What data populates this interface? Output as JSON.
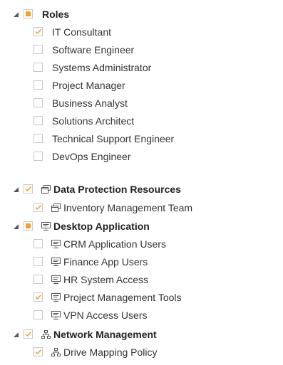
{
  "colors": {
    "check": "#f0a030",
    "border": "#c8c8c8",
    "text": "#333333",
    "icon": "#555555"
  },
  "tree": [
    {
      "label": "Roles",
      "state": "partial",
      "icon": null,
      "children": [
        {
          "label": "IT Consultant",
          "state": "checked",
          "icon": null
        },
        {
          "label": "Software Engineer",
          "state": "unchecked",
          "icon": null
        },
        {
          "label": "Systems Administrator",
          "state": "unchecked",
          "icon": null
        },
        {
          "label": "Project Manager",
          "state": "unchecked",
          "icon": null
        },
        {
          "label": "Business Analyst",
          "state": "unchecked",
          "icon": null
        },
        {
          "label": "Solutions Architect",
          "state": "unchecked",
          "icon": null
        },
        {
          "label": "Technical Support Engineer",
          "state": "unchecked",
          "icon": null
        },
        {
          "label": "DevOps Engineer",
          "state": "unchecked",
          "icon": null
        }
      ]
    },
    {
      "label": "Data Protection Resources",
      "state": "checked",
      "icon": "stacked-windows-icon",
      "children": [
        {
          "label": "Inventory Management Team",
          "state": "checked",
          "icon": "stacked-windows-icon"
        }
      ]
    },
    {
      "label": "Desktop Application",
      "state": "partial",
      "icon": "desktop-app-icon",
      "children": [
        {
          "label": "CRM Application Users",
          "state": "unchecked",
          "icon": "desktop-app-icon"
        },
        {
          "label": "Finance App Users",
          "state": "unchecked",
          "icon": "desktop-app-icon"
        },
        {
          "label": "HR System Access",
          "state": "unchecked",
          "icon": "desktop-app-icon"
        },
        {
          "label": "Project Management Tools",
          "state": "checked",
          "icon": "desktop-app-icon"
        },
        {
          "label": "VPN Access Users",
          "state": "unchecked",
          "icon": "desktop-app-icon"
        }
      ]
    },
    {
      "label": "Network Management",
      "state": "checked",
      "icon": "network-icon",
      "children": [
        {
          "label": "Drive Mapping Policy",
          "state": "checked",
          "icon": "network-icon"
        }
      ]
    }
  ]
}
